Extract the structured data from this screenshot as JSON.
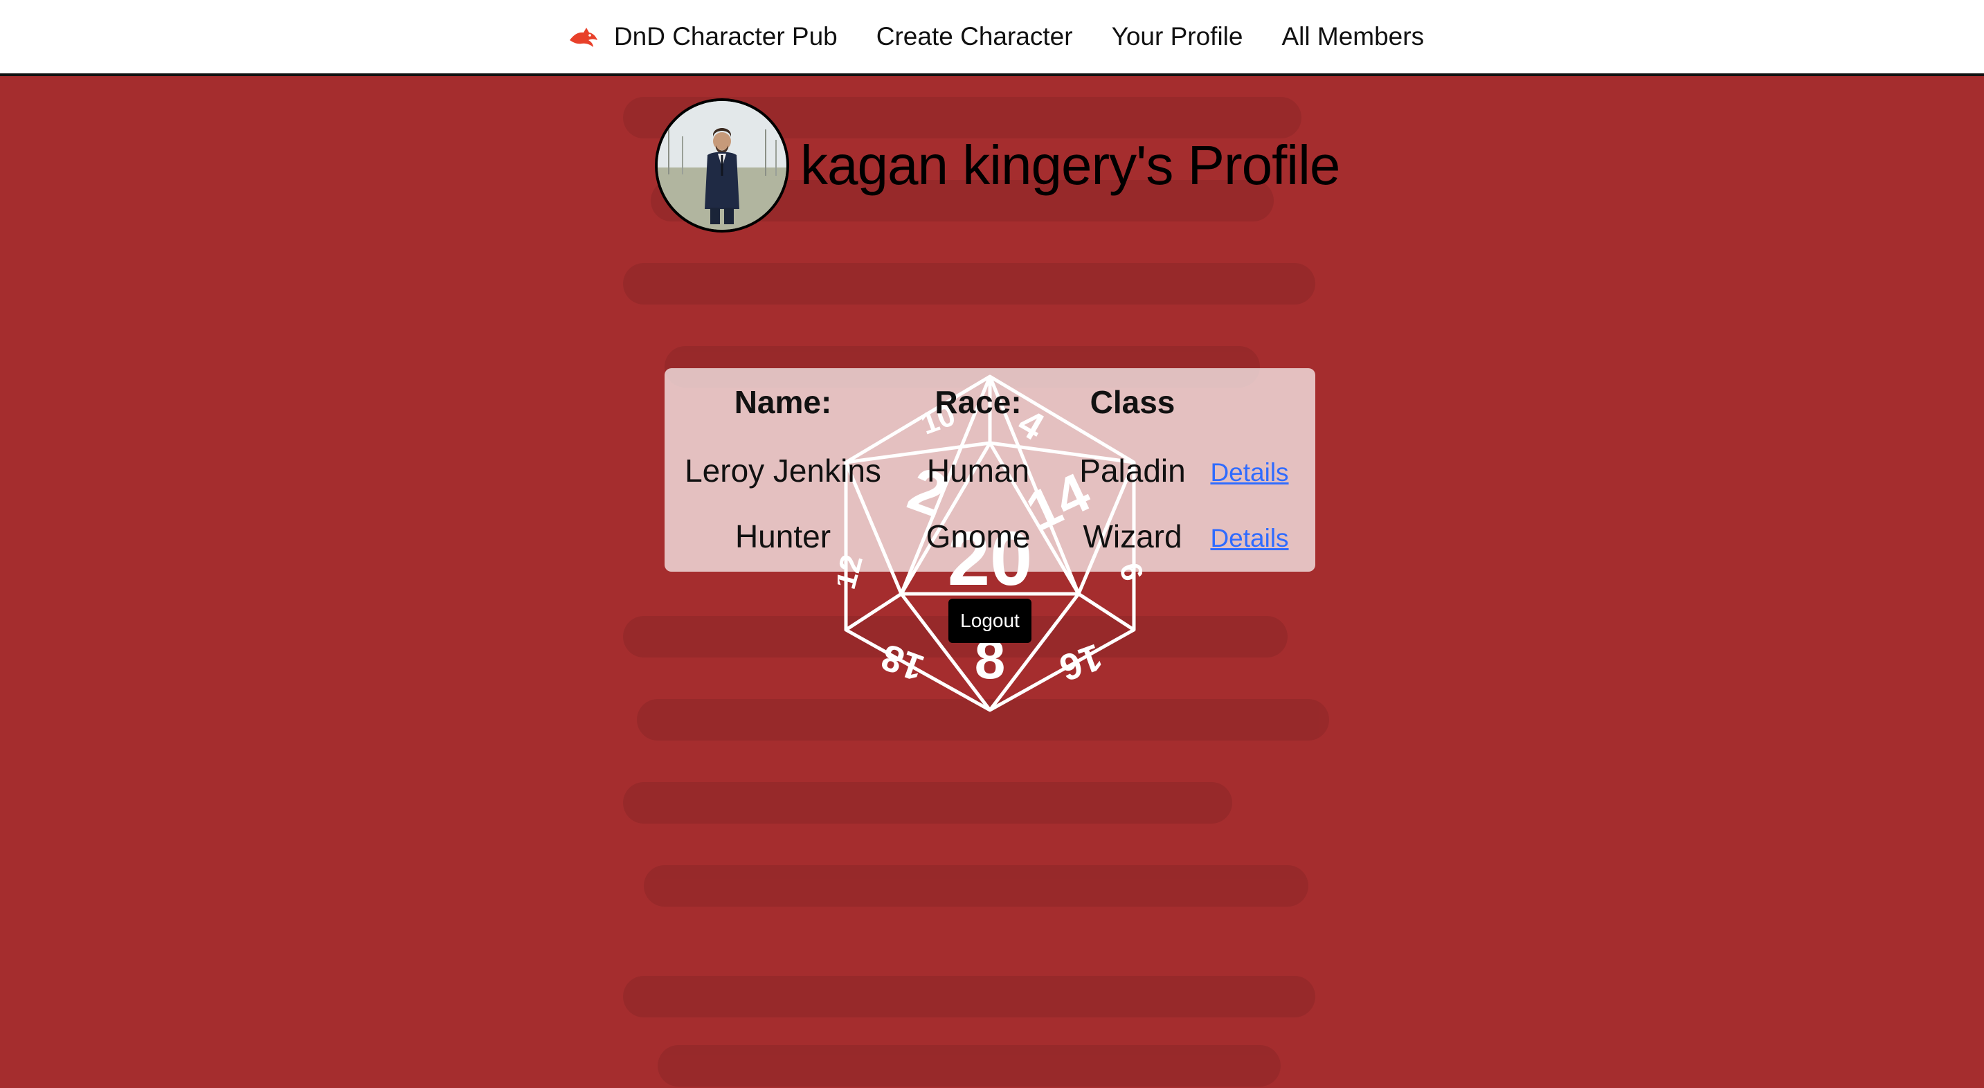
{
  "nav": {
    "brand_label": "DnD Character Pub",
    "links": [
      "Create Character",
      "Your Profile",
      "All Members"
    ],
    "brand_icon": "dragon-icon",
    "brand_color": "#e8402a"
  },
  "profile": {
    "title": "kagan kingery's Profile",
    "avatar_icon": "avatar-photo"
  },
  "table": {
    "headers": [
      "Name:",
      "Race:",
      "Class"
    ],
    "rows": [
      {
        "name": "Leroy Jenkins",
        "race": "Human",
        "class": "Paladin",
        "link": "Details"
      },
      {
        "name": "Hunter",
        "race": "Gnome",
        "class": "Wizard",
        "link": "Details"
      }
    ]
  },
  "center_die": {
    "icon": "d20-icon",
    "labels": [
      "20",
      "2",
      "14",
      "4",
      "10",
      "12",
      "6",
      "8",
      "18",
      "16"
    ]
  },
  "logout_label": "Logout",
  "colors": {
    "background": "#a52d2e",
    "navbar": "#ffffff",
    "table_panel": "rgba(255,255,255,0.70)",
    "link": "#2f6bff"
  }
}
